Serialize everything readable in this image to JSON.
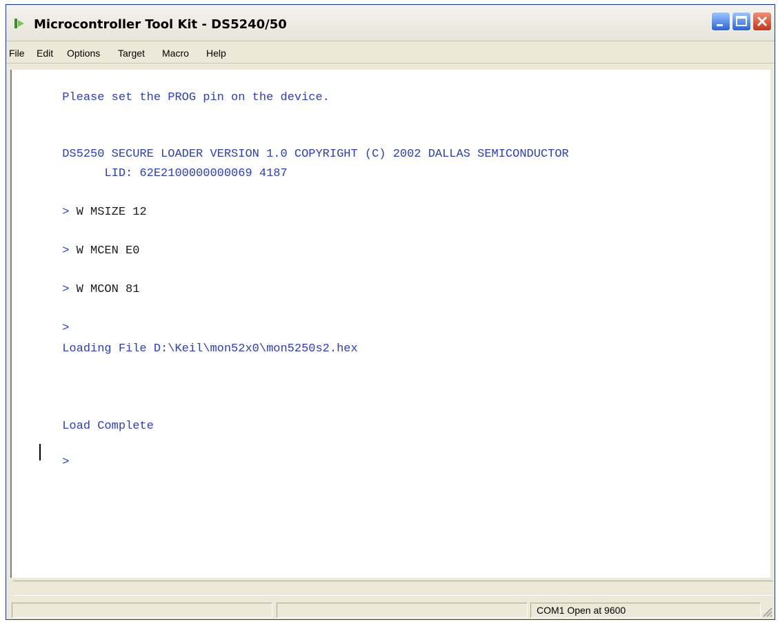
{
  "window": {
    "title": "Microcontroller Tool Kit - DS5240/50"
  },
  "menubar": {
    "items": [
      "File",
      "Edit",
      "Options",
      "Target",
      "Macro",
      "Help"
    ]
  },
  "console": {
    "lines": [
      {
        "text": "Please set the PROG pin on the device.",
        "kind": "output"
      },
      {
        "text": "DS5250 SECURE LOADER VERSION 1.0 COPYRIGHT (C) 2002 DALLAS SEMICONDUCTOR",
        "kind": "output"
      },
      {
        "text": "      LID: 62E2100000000069 4187",
        "kind": "output"
      },
      {
        "prompt": ">",
        "text": " W MSIZE 12",
        "kind": "command"
      },
      {
        "prompt": ">",
        "text": " W MCEN E0",
        "kind": "command"
      },
      {
        "prompt": ">",
        "text": " W MCON 81",
        "kind": "command"
      },
      {
        "prompt": ">",
        "text": "",
        "kind": "command"
      },
      {
        "text": "Loading File D:\\Keil\\mon52x0\\mon5250s2.hex",
        "kind": "output"
      },
      {
        "text": "Load Complete",
        "kind": "output"
      },
      {
        "prompt": ">",
        "text": "",
        "kind": "command"
      }
    ]
  },
  "statusbar": {
    "panes": [
      "",
      "",
      "COM1 Open at 9600"
    ]
  },
  "colors": {
    "console_text": "#2a3bd1",
    "command_text": "#1a1a1a",
    "close_button": "#c53719"
  },
  "icons": {
    "app": "app-logo-icon",
    "minimize": "minimize-icon",
    "maximize": "maximize-icon",
    "close": "close-icon",
    "grip": "resize-grip-icon"
  }
}
